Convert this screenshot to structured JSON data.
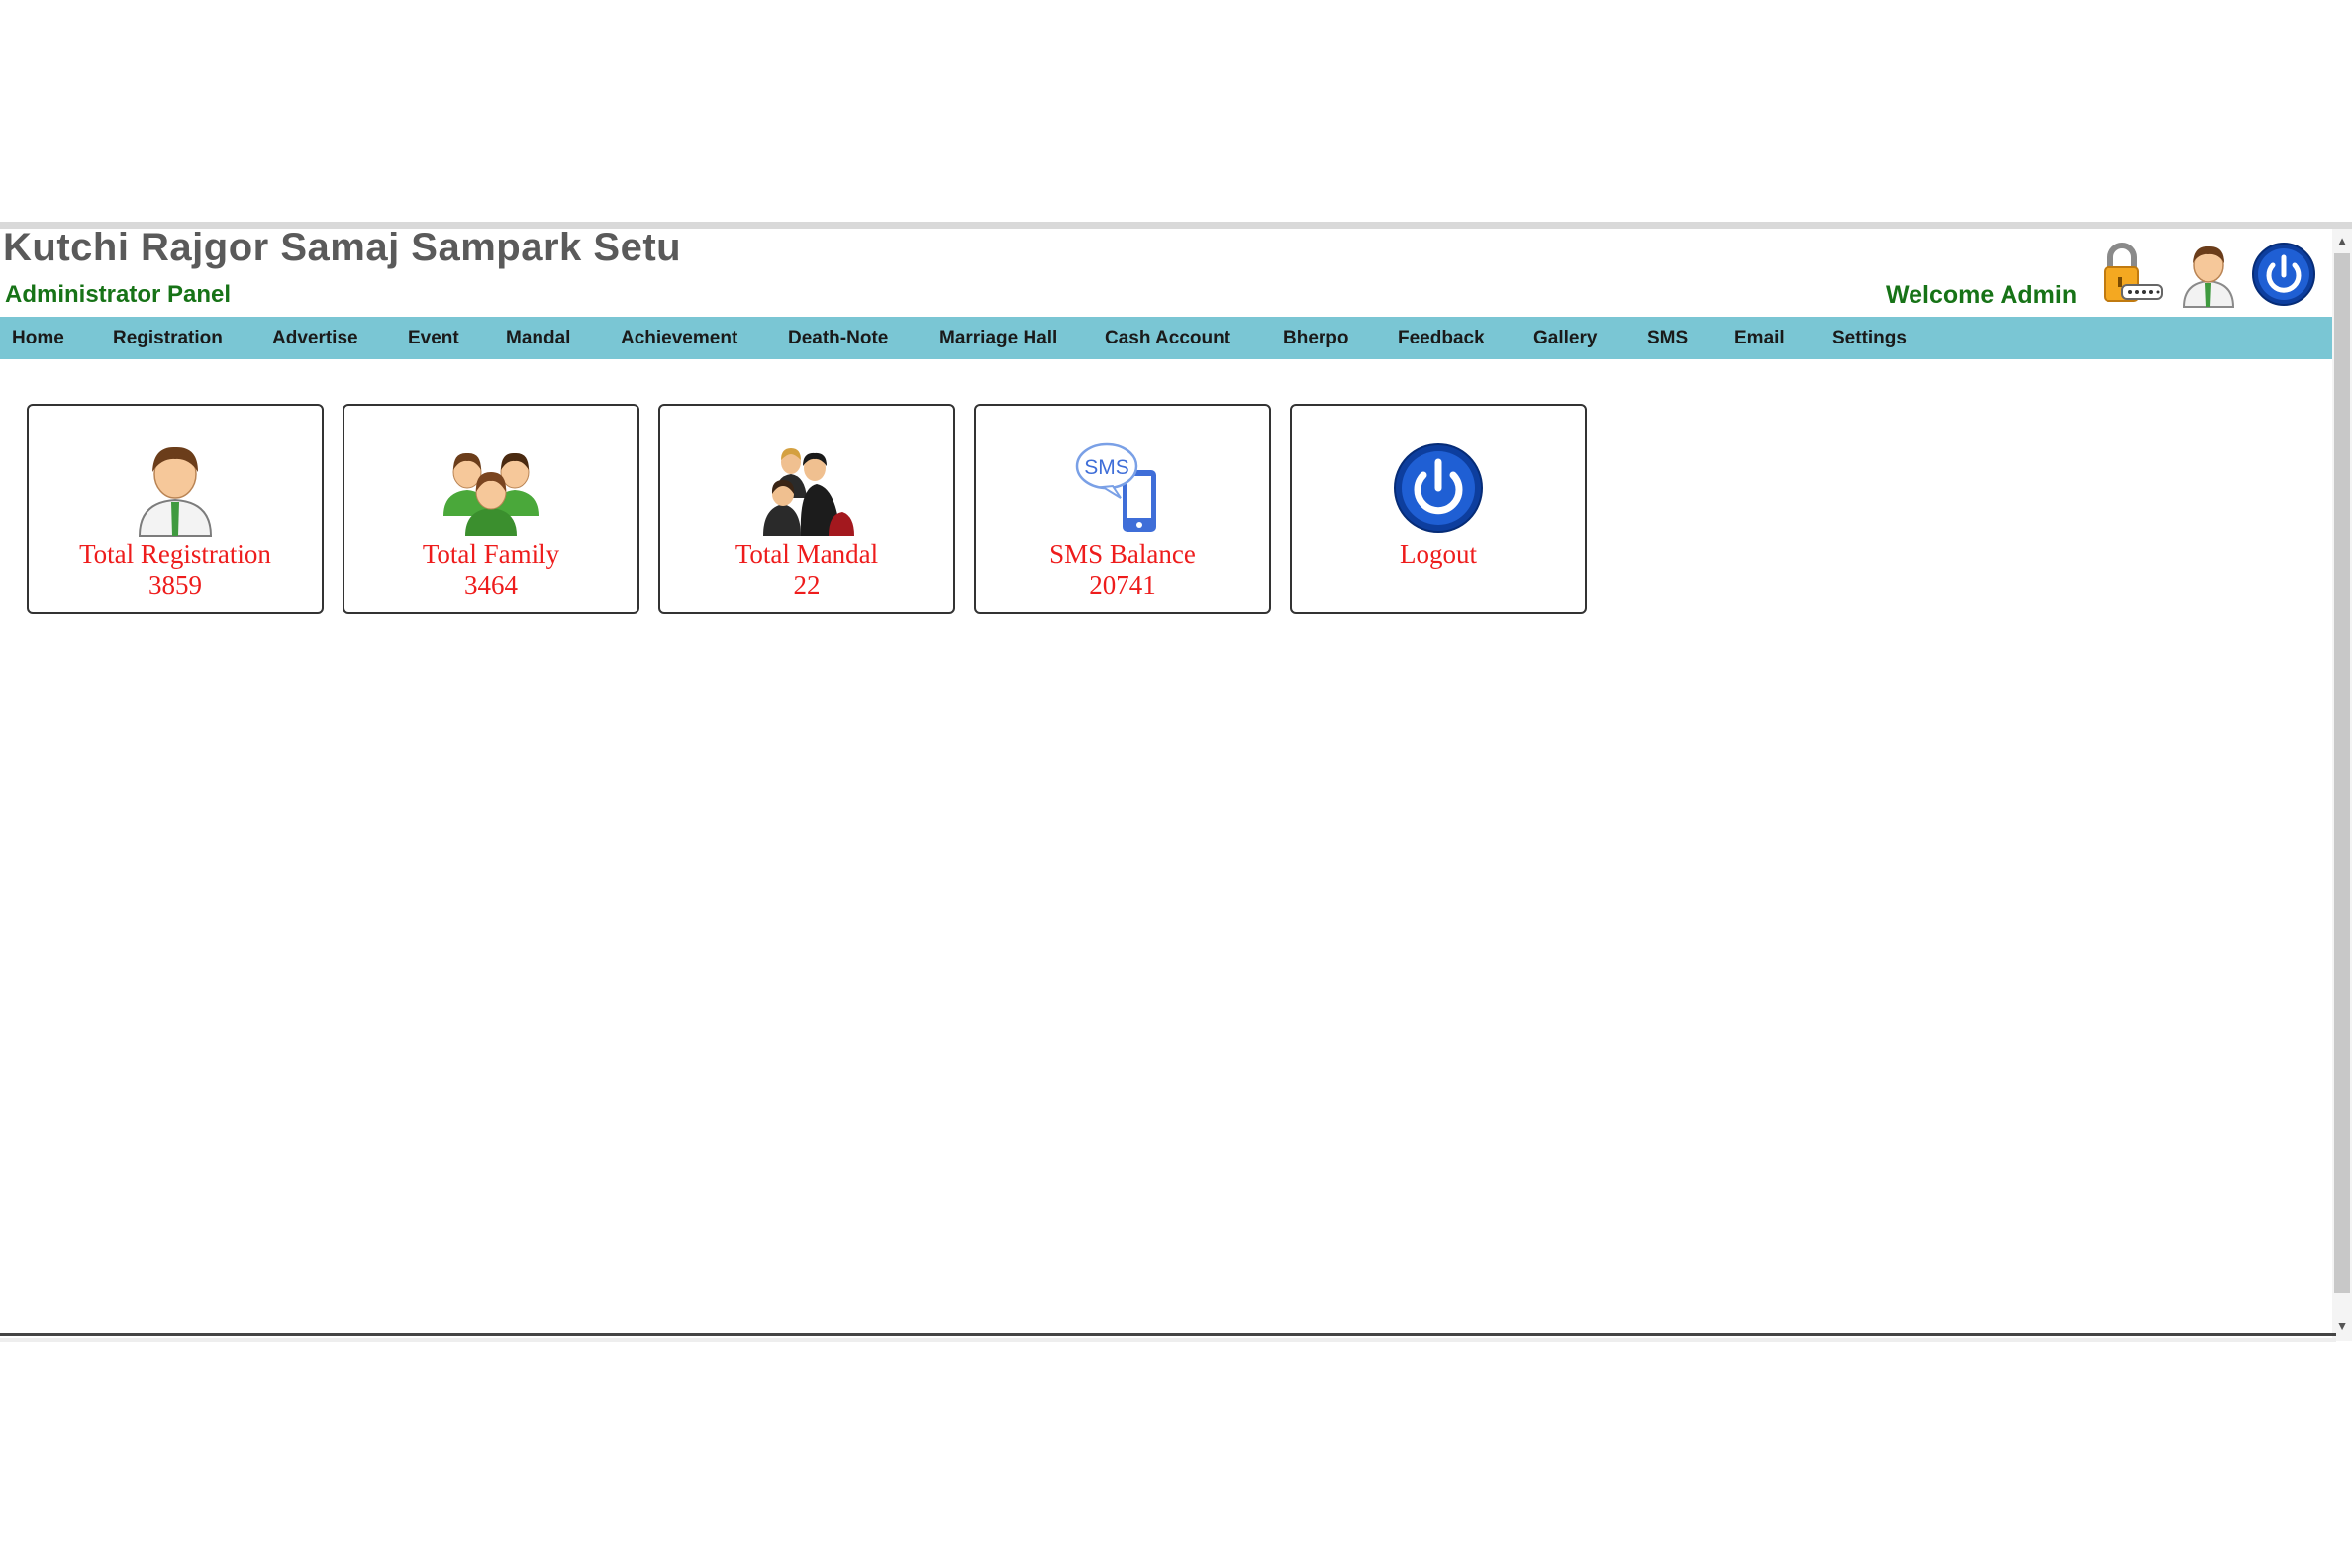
{
  "header": {
    "title": "Kutchi Rajgor Samaj Sampark Setu",
    "subtitle": "Administrator Panel",
    "welcome": "Welcome Admin",
    "icons": [
      "lock-icon",
      "user-icon",
      "power-icon"
    ]
  },
  "nav": {
    "items": [
      {
        "label": "Home"
      },
      {
        "label": "Registration"
      },
      {
        "label": "Advertise"
      },
      {
        "label": "Event"
      },
      {
        "label": "Mandal"
      },
      {
        "label": "Achievement"
      },
      {
        "label": "Death-Note"
      },
      {
        "label": "Marriage Hall"
      },
      {
        "label": "Cash Account"
      },
      {
        "label": "Bherpo"
      },
      {
        "label": "Feedback"
      },
      {
        "label": "Gallery"
      },
      {
        "label": "SMS"
      },
      {
        "label": "Email"
      },
      {
        "label": "Settings"
      }
    ]
  },
  "dashboard": {
    "cards": [
      {
        "label": "Total Registration",
        "value": "3859",
        "icon": "user-icon"
      },
      {
        "label": "Total Family",
        "value": "3464",
        "icon": "family-icon"
      },
      {
        "label": "Total Mandal",
        "value": "22",
        "icon": "group-icon"
      },
      {
        "label": "SMS Balance",
        "value": "20741",
        "icon": "sms-phone-icon"
      },
      {
        "label": "Logout",
        "value": "",
        "icon": "power-icon"
      }
    ]
  },
  "colors": {
    "nav_bg": "#7ac6d4",
    "title": "#5a5a5a",
    "subtitle": "#177317",
    "card_text": "#ee1c1c"
  }
}
